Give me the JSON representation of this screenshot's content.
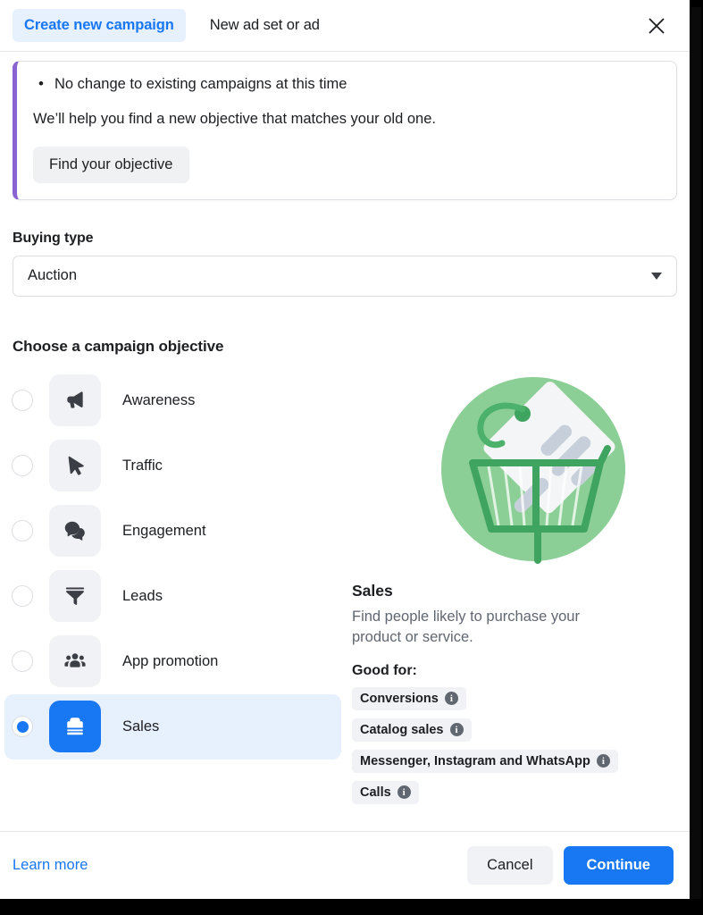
{
  "header": {
    "tab_active": "Create new campaign",
    "tab_inactive": "New ad set or ad",
    "close_icon": "close-icon"
  },
  "notice": {
    "bullets": [
      "No change to existing campaigns at this time"
    ],
    "paragraph": "We’ll help you find a new objective that matches your old one.",
    "button_label": "Find your objective",
    "accent_color": "#8a63d2"
  },
  "buying_type": {
    "label": "Buying type",
    "value": "Auction",
    "caret_icon": "chevron-down-icon"
  },
  "objectives": {
    "title": "Choose a campaign objective",
    "items": [
      {
        "label": "Awareness",
        "icon": "megaphone-icon",
        "selected": false
      },
      {
        "label": "Traffic",
        "icon": "cursor-icon",
        "selected": false
      },
      {
        "label": "Engagement",
        "icon": "chat-bubbles-icon",
        "selected": false
      },
      {
        "label": "Leads",
        "icon": "funnel-icon",
        "selected": false
      },
      {
        "label": "App promotion",
        "icon": "people-group-icon",
        "selected": false
      },
      {
        "label": "Sales",
        "icon": "briefcase-icon",
        "selected": true
      }
    ],
    "selected_accent": "#1877f2"
  },
  "detail": {
    "illustration": "shopping-cart-with-price-tag",
    "title": "Sales",
    "description": "Find people likely to purchase your product or service.",
    "good_for_label": "Good for:",
    "chips": [
      {
        "label": "Conversions",
        "info": "i"
      },
      {
        "label": "Catalog sales",
        "info": "i"
      },
      {
        "label": "Messenger, Instagram and WhatsApp",
        "info": "i"
      },
      {
        "label": "Calls",
        "info": "i"
      }
    ]
  },
  "footer": {
    "learn_more": "Learn more",
    "cancel": "Cancel",
    "continue": "Continue"
  }
}
